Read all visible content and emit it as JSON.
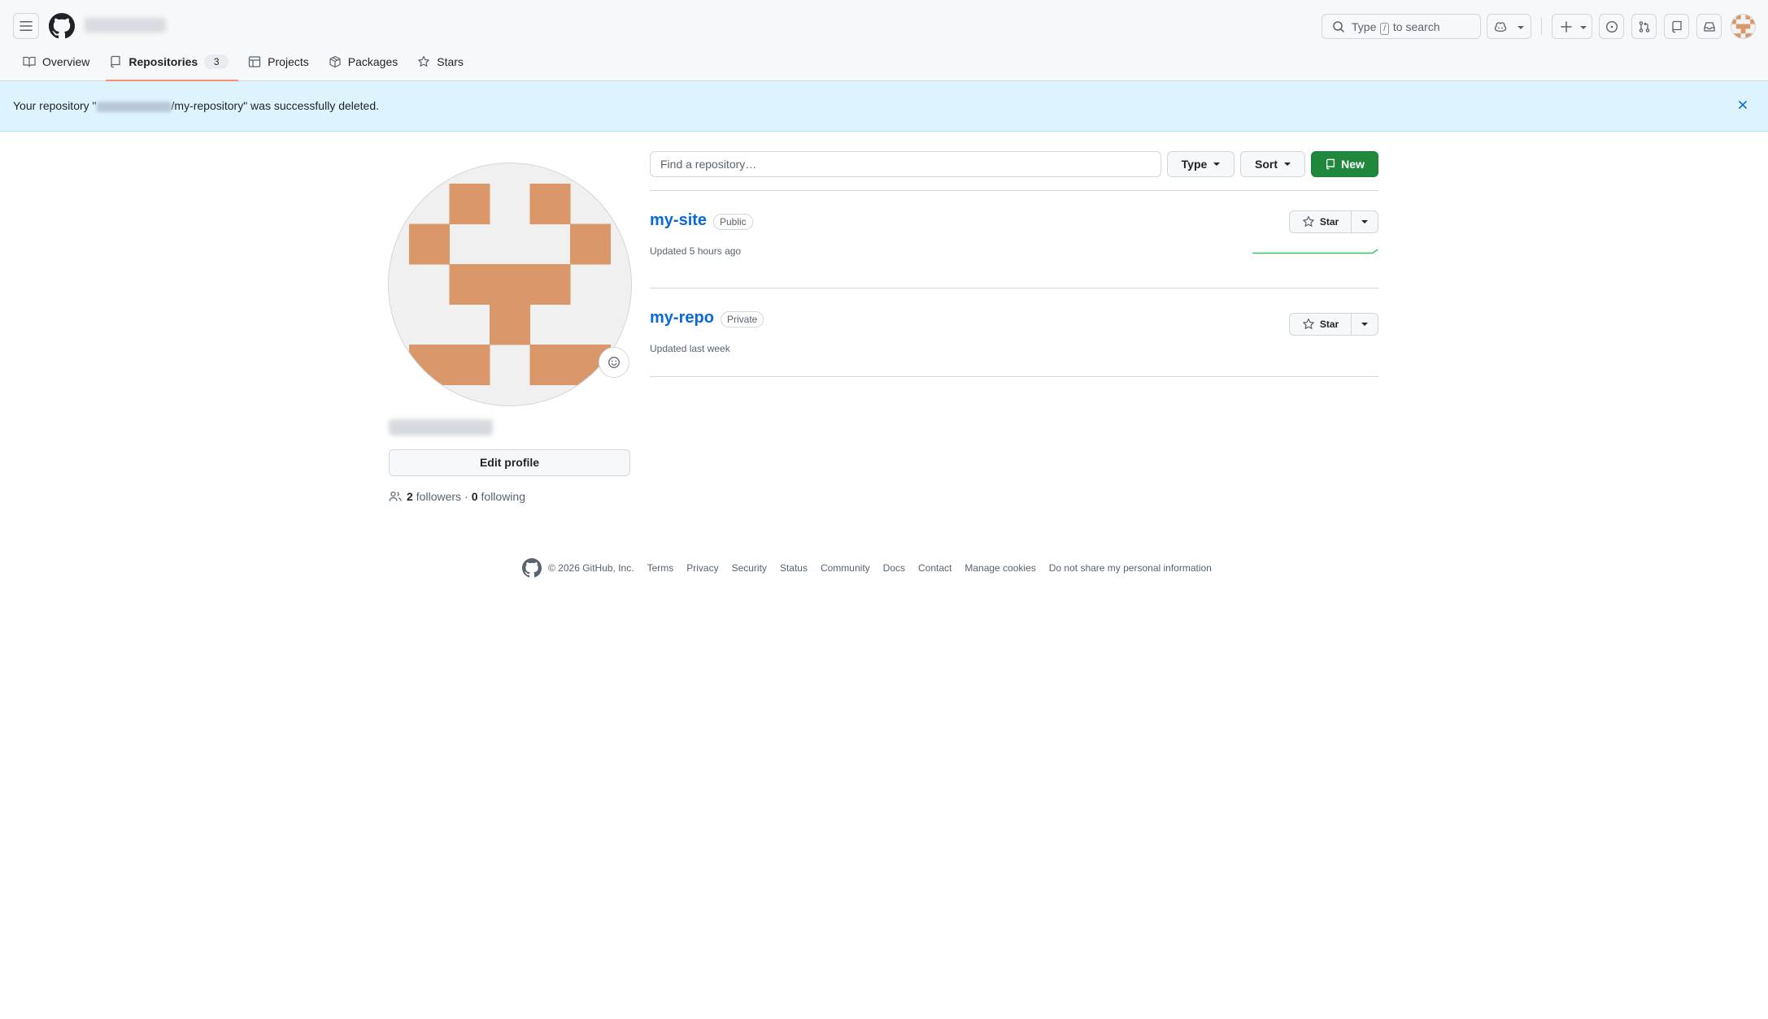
{
  "header": {
    "search_text_before": "Type",
    "search_key": "/",
    "search_text_after": "to search"
  },
  "tabs": [
    {
      "label": "Overview",
      "icon": "book-icon"
    },
    {
      "label": "Repositories",
      "icon": "repo-icon",
      "count": "3",
      "active": true
    },
    {
      "label": "Projects",
      "icon": "table-icon"
    },
    {
      "label": "Packages",
      "icon": "package-icon"
    },
    {
      "label": "Stars",
      "icon": "star-icon"
    }
  ],
  "flash": {
    "prefix": "Your repository \"",
    "suffix": "/my-repository\" was successfully deleted."
  },
  "profile": {
    "edit_label": "Edit profile",
    "followers_count": "2",
    "followers_label": "followers",
    "separator": "·",
    "following_count": "0",
    "following_label": "following",
    "avatar_color": "#d9976a"
  },
  "repo_toolbar": {
    "search_placeholder": "Find a repository…",
    "type_label": "Type",
    "sort_label": "Sort",
    "new_label": "New"
  },
  "repos": [
    {
      "name": "my-site",
      "visibility": "Public",
      "updated": "Updated 5 hours ago",
      "star_label": "Star"
    },
    {
      "name": "my-repo",
      "visibility": "Private",
      "updated": "Updated last week",
      "star_label": "Star"
    }
  ],
  "footer": {
    "copyright": "© 2026 GitHub, Inc.",
    "links": [
      "Terms",
      "Privacy",
      "Security",
      "Status",
      "Community",
      "Docs",
      "Contact",
      "Manage cookies",
      "Do not share my personal information"
    ]
  },
  "colors": {
    "accent_blue": "#0969da",
    "new_button_green": "#1f883d",
    "flash_bg": "#ddf4ff",
    "active_tab_underline": "#fd8c73"
  }
}
